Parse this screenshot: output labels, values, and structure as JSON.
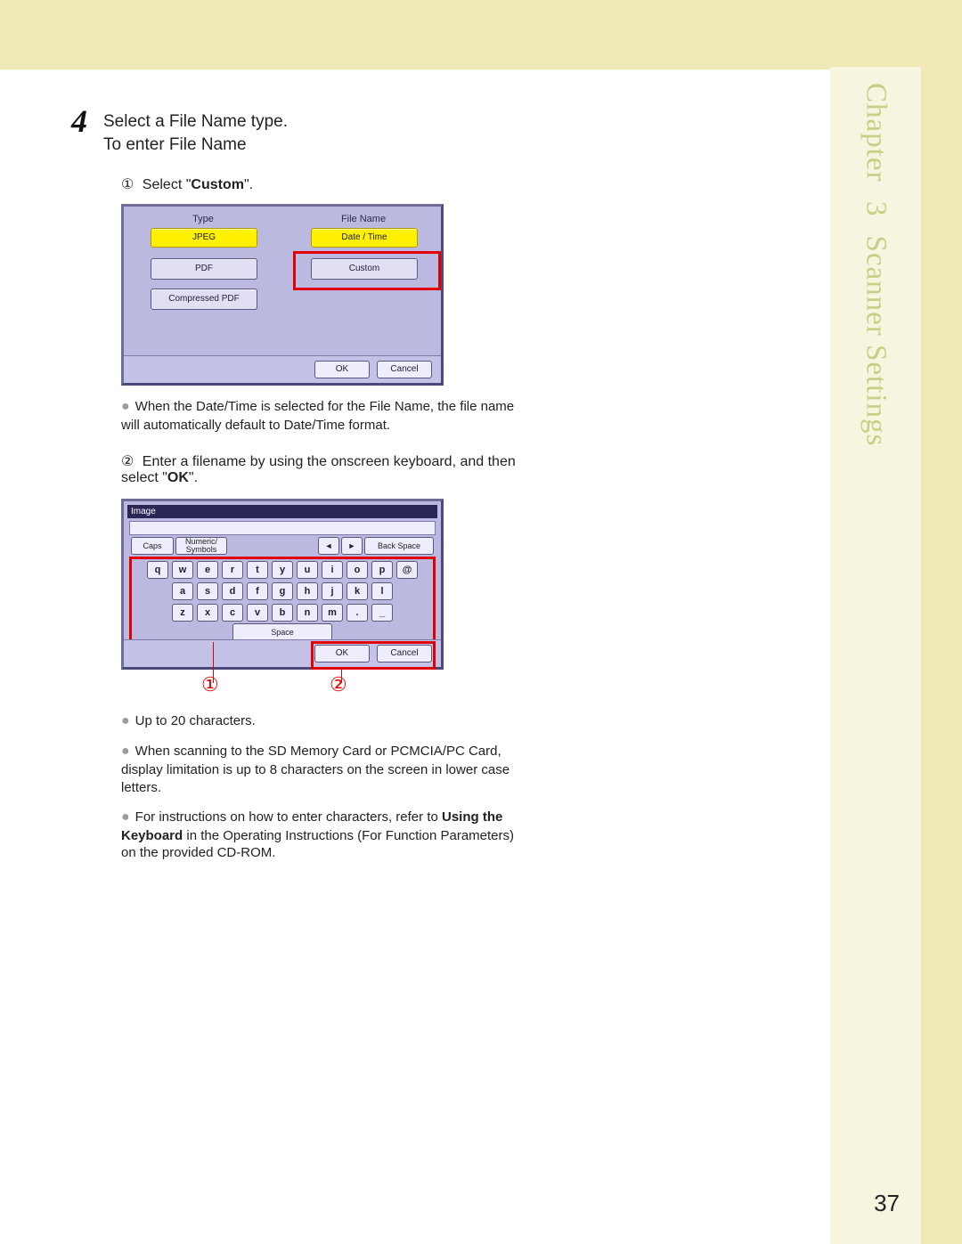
{
  "sidebar": {
    "chapter_word": "Chapter",
    "chapter_number": "3",
    "chapter_title": "Scanner Settings"
  },
  "page_number": "37",
  "step": {
    "number": "4",
    "line1": "Select a File Name type.",
    "line2": "To enter File Name"
  },
  "sub1": {
    "num": "①",
    "pre": "Select \"",
    "bold": "Custom",
    "post": "\"."
  },
  "shot1": {
    "hdr_type": "Type",
    "hdr_fn": "File Name",
    "btn_jpeg": "JPEG",
    "btn_pdf": "PDF",
    "btn_cpdf": "Compressed PDF",
    "btn_dt": "Date / Time",
    "btn_custom": "Custom",
    "ok": "OK",
    "cancel": "Cancel"
  },
  "b1": "When the Date/Time is selected for the File Name, the file name will automatically default to Date/Time format.",
  "sub2": {
    "num": "②",
    "pre": "Enter a filename by using the onscreen keyboard, and then select \"",
    "bold": "OK",
    "post": "\"."
  },
  "shot2": {
    "title": "Image",
    "caps": "Caps",
    "numsym": "Numeric/\nSymbols",
    "left": "◄",
    "right": "►",
    "bksp": "Back Space",
    "row1": [
      "q",
      "w",
      "e",
      "r",
      "t",
      "y",
      "u",
      "i",
      "o",
      "p",
      "@"
    ],
    "row2": [
      "a",
      "s",
      "d",
      "f",
      "g",
      "h",
      "j",
      "k",
      "l"
    ],
    "row3": [
      "z",
      "x",
      "c",
      "v",
      "b",
      "n",
      "m",
      ".",
      "_"
    ],
    "space": "Space",
    "ok": "OK",
    "cancel": "Cancel",
    "mark1": "①",
    "mark2": "②"
  },
  "b2": "Up to 20 characters.",
  "b3": "When scanning to the SD Memory Card or PCMCIA/PC Card, display limitation is up to 8 characters on the screen in lower case letters.",
  "b4": {
    "pre": "For instructions on how to enter characters, refer to ",
    "bold": "Using the Keyboard",
    "post": " in the Operating Instructions (For Function Parameters) on the provided CD-ROM."
  }
}
